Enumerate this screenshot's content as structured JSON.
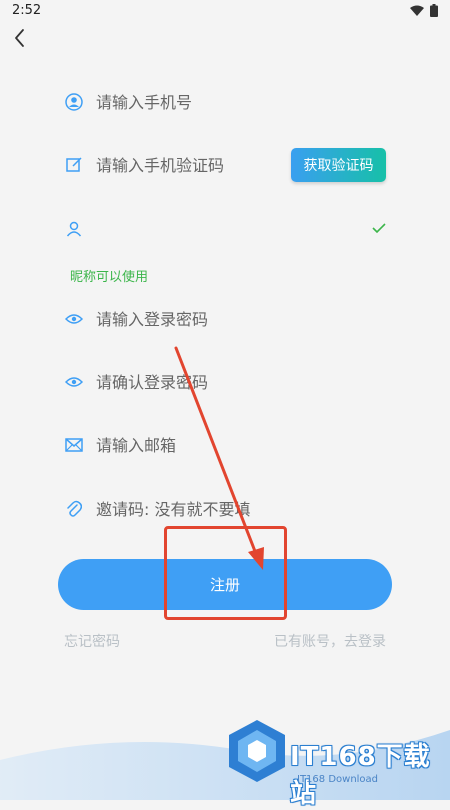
{
  "status_bar": {
    "time": "2:52"
  },
  "form": {
    "phone_placeholder": "请输入手机号",
    "sms_code_placeholder": "请输入手机验证码",
    "get_code_label": "获取验证码",
    "nickname_value": "",
    "nickname_status": "昵称可以使用",
    "password_placeholder": "请输入登录密码",
    "confirm_password_placeholder": "请确认登录密码",
    "email_placeholder": "请输入邮箱",
    "invite_placeholder": "邀请码: 没有就不要填"
  },
  "register_label": "注册",
  "forgot_password": "忘记密码",
  "has_account_login": "已有账号，去登录",
  "watermark": {
    "main": "IT168下载站",
    "sub": "IT168 Download"
  },
  "colors": {
    "primary": "#3f9ff5",
    "success": "#3bb54a",
    "annotation": "#e2452f",
    "gradient_start": "#3a9ff0",
    "gradient_end": "#17c0a8"
  },
  "icons": {
    "back": "chevron-left-icon",
    "phone": "user-circle-icon",
    "code": "edit-icon",
    "nickname": "user-icon",
    "nickname_ok": "check-icon",
    "password": "eye-icon",
    "email": "mail-icon",
    "invite": "paperclip-icon"
  }
}
